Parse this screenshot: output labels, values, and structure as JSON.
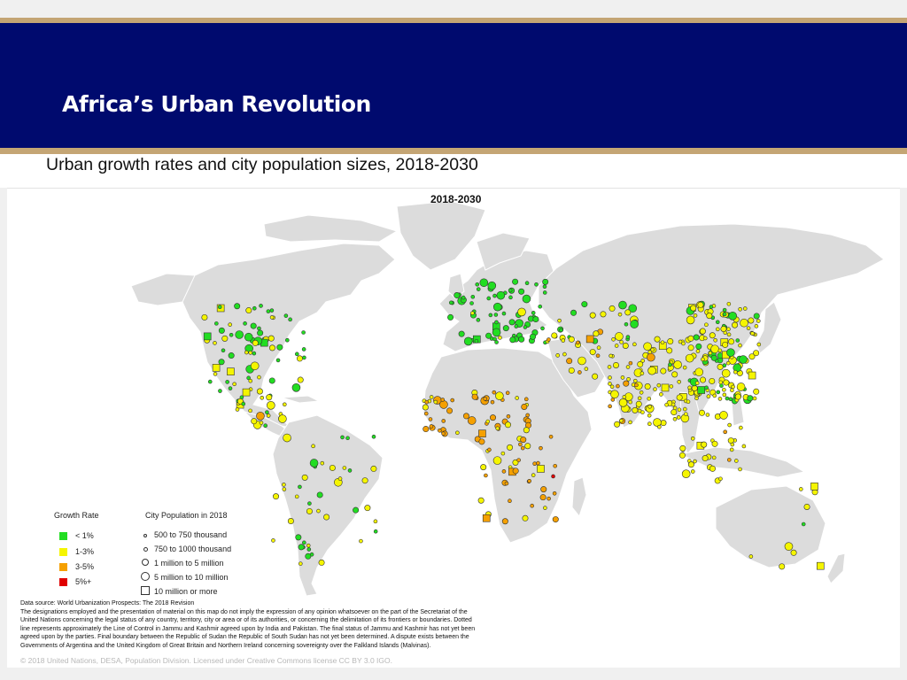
{
  "slide": {
    "title": "Africa’s Urban Revolution",
    "subtitle": "Urban growth rates and city population sizes, 2018-2030"
  },
  "map": {
    "title": "2018-2030",
    "land_color": "#dcdcdc",
    "border_color": "#ffffff"
  },
  "legend": {
    "growth_rate": {
      "heading": "Growth Rate",
      "items": [
        {
          "label": "< 1%",
          "color": "#22dd22"
        },
        {
          "label": "1-3%",
          "color": "#f5f500"
        },
        {
          "label": "3-5%",
          "color": "#f5a000"
        },
        {
          "label": "5%+",
          "color": "#e00000"
        }
      ]
    },
    "city_population": {
      "heading": "City Population in 2018",
      "items": [
        {
          "label": "500 to 750 thousand",
          "symbol": "tiny-circle"
        },
        {
          "label": "750 to 1000 thousand",
          "symbol": "small-circle"
        },
        {
          "label": "1 million to 5 million",
          "symbol": "circle"
        },
        {
          "label": "5 million to 10 million",
          "symbol": "large-circle"
        },
        {
          "label": "10 million or more",
          "symbol": "square"
        }
      ]
    }
  },
  "notes": {
    "source": "Data source: World Urbanization Prospects: The 2018 Revision",
    "line1": "The designations employed and the presentation of material on this map do not imply the expression of any opinion whatsoever on the part of the Secretariat of the",
    "line2": "United Nations concerning the legal status of any country, territory, city or area or of its authorities, or concerning the delimitation of its frontiers or boundaries. Dotted",
    "line3": "line represents approximately the Line of Control in Jammu and Kashmir agreed upon by India and Pakistan. The final status of Jammu and Kashmir has not yet been",
    "line4": "agreed upon by the parties. Final boundary between the Republic of Sudan the Republic of South Sudan has not yet been determined. A dispute exists between the",
    "line5": "Governments of Argentina and the United Kingdom of Great Britain and Northern Ireland concerning sovereignty over the Falkland Islands (Malvinas).",
    "copyright": "© 2018 United Nations, DESA, Population Division. Licensed under Creative Commons license CC BY 3.0 IGO."
  }
}
